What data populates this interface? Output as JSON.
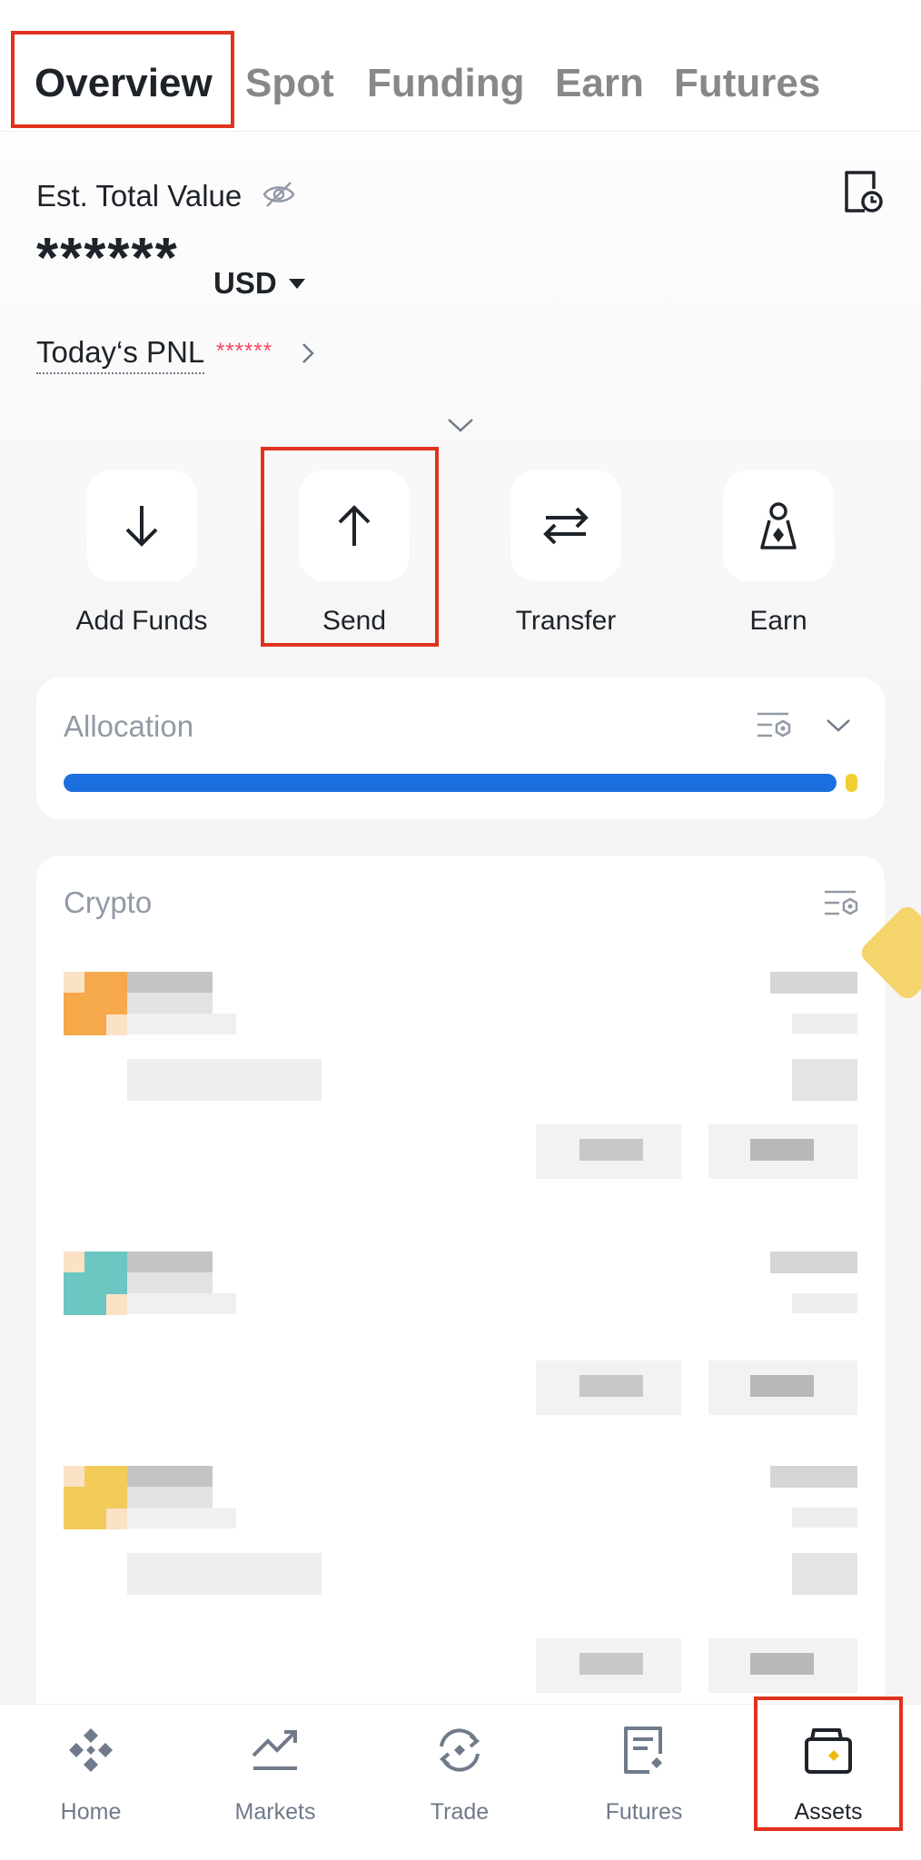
{
  "tabs": [
    {
      "label": "Overview",
      "active": true
    },
    {
      "label": "Spot",
      "active": false
    },
    {
      "label": "Funding",
      "active": false
    },
    {
      "label": "Earn",
      "active": false
    },
    {
      "label": "Futures",
      "active": false
    }
  ],
  "overview": {
    "est_label": "Est. Total Value",
    "masked_total": "******",
    "currency": "USD",
    "pnl_label": "Today‘s PNL",
    "pnl_value": "******"
  },
  "actions": [
    {
      "label": "Add Funds",
      "icon": "arrow-down-icon"
    },
    {
      "label": "Send",
      "icon": "arrow-up-icon"
    },
    {
      "label": "Transfer",
      "icon": "transfer-icon"
    },
    {
      "label": "Earn",
      "icon": "earn-icon"
    }
  ],
  "allocation": {
    "title": "Allocation",
    "bar": [
      {
        "share": 0.985,
        "color": "#1c6fdf"
      },
      {
        "share": 0.015,
        "color": "#f0d030"
      }
    ]
  },
  "crypto": {
    "title": "Crypto",
    "rows": [
      {
        "accent": "#f5a94a"
      },
      {
        "accent": "#6cc6c2"
      },
      {
        "accent": "#f2cb5a"
      }
    ]
  },
  "bottom_nav": [
    {
      "label": "Home",
      "icon": "home-icon",
      "active": false
    },
    {
      "label": "Markets",
      "icon": "markets-icon",
      "active": false
    },
    {
      "label": "Trade",
      "icon": "trade-icon",
      "active": false
    },
    {
      "label": "Futures",
      "icon": "futures-icon",
      "active": false
    },
    {
      "label": "Assets",
      "icon": "wallet-icon",
      "active": true
    }
  ],
  "colors": {
    "accent": "#f0b90b",
    "highlight_box": "#e1321e",
    "primary_text": "#1e2329",
    "muted_text": "#929aa5",
    "loss": "#f6465d",
    "allocation_blue": "#1c6fdf"
  }
}
